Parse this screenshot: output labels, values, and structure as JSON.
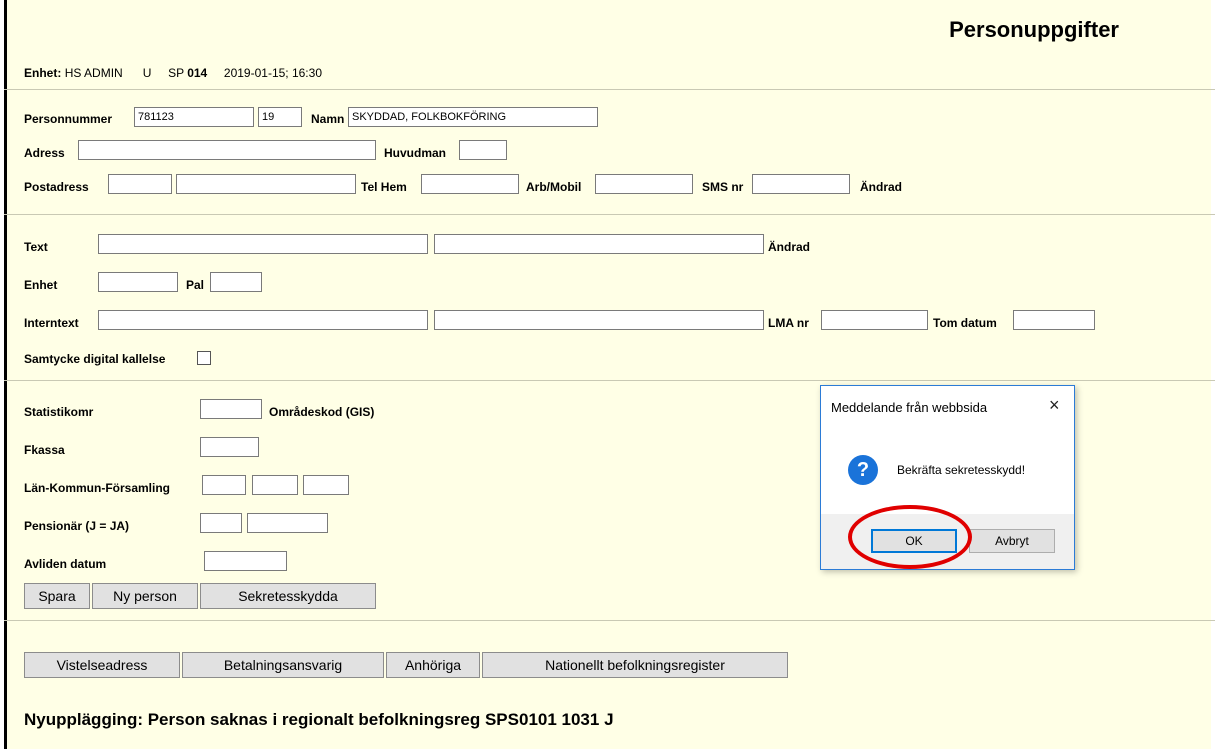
{
  "title": "Personuppgifter",
  "header": {
    "enhet_label": "Enhet:",
    "enhet_value": "HS ADMIN",
    "u": "U",
    "sp_label": "SP",
    "sp_value": "014",
    "timestamp": "2019-01-15; 16:30"
  },
  "person": {
    "personnummer_label": "Personnummer",
    "personnummer_value": "781123",
    "century_value": "19",
    "namn_label": "Namn",
    "namn_value": "SKYDDAD, FOLKBOKFÖRING",
    "adress_label": "Adress",
    "huvudman_label": "Huvudman",
    "postadress_label": "Postadress",
    "telhem_label": "Tel Hem",
    "arbmobil_label": "Arb/Mobil",
    "smsnr_label": "SMS nr",
    "andrad_label": "Ändrad"
  },
  "notes": {
    "text_label": "Text",
    "andrad_label": "Ändrad",
    "enhet_label": "Enhet",
    "pal_label": "Pal",
    "interntext_label": "Interntext",
    "lmanr_label": "LMA nr",
    "tomdatum_label": "Tom datum",
    "samtycke_label": "Samtycke digital kallelse"
  },
  "stats": {
    "statistikomr_label": "Statistikomr",
    "omradeskod_label": "Områdeskod (GIS)",
    "fkassa_label": "Fkassa",
    "lkf_label": "Län-Kommun-Församling",
    "pensionar_label": "Pensionär (J = JA)",
    "avliden_label": "Avliden datum"
  },
  "actions": {
    "spara": "Spara",
    "ny_person": "Ny person",
    "sekretesskydda": "Sekretesskydda"
  },
  "nav": {
    "vistelseadress": "Vistelseadress",
    "betalningsansvarig": "Betalningsansvarig",
    "anhoriga": "Anhöriga",
    "nationellt": "Nationellt befolkningsregister"
  },
  "status_message": "Nyupplägging: Person saknas i regionalt befolkningsreg SPS0101 1031 J",
  "dialog": {
    "title": "Meddelande från webbsida",
    "close": "×",
    "icon": "question-icon",
    "message": "Bekräfta sekretesskydd!",
    "ok": "OK",
    "cancel": "Avbryt"
  },
  "colors": {
    "page_bg": "#ffffe6",
    "accent_blue": "#1a73d9",
    "highlight_red": "#e00000"
  }
}
